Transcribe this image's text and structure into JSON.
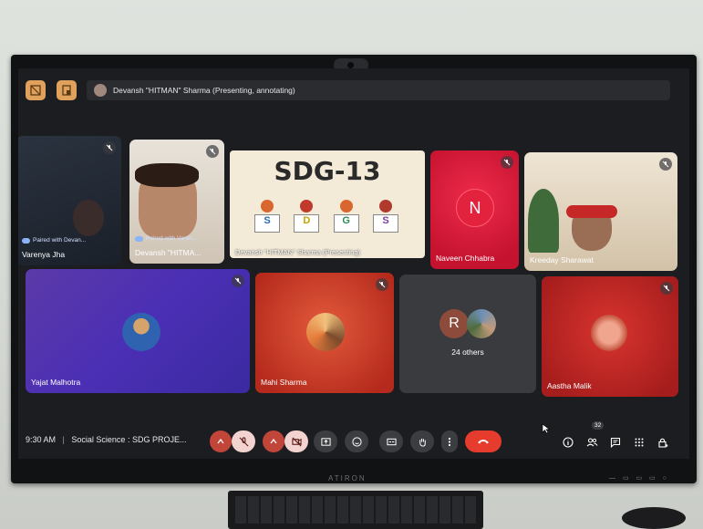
{
  "presenter_bar": {
    "text": "Devansh \"HITMAN\" Sharma (Presenting, annotating)"
  },
  "tiles": {
    "varenya": {
      "name": "Varenya Jha",
      "paired": "Paired with Devan..."
    },
    "devansh": {
      "name": "Devansh \"HITMA...",
      "paired": "Paired with Varen..."
    },
    "presentation": {
      "title": "SDG-13",
      "letters": [
        "S",
        "D",
        "G",
        "S"
      ],
      "footer": "Devansh \"HITMAN\" Sharma (Presenting)"
    },
    "naveen": {
      "name": "Naveen Chhabra",
      "initial": "N"
    },
    "kreeday": {
      "name": "Kreeday Sharawat"
    },
    "yajat": {
      "name": "Yajat Malhotra"
    },
    "mahi": {
      "name": "Mahi Sharma"
    },
    "others": {
      "initial": "R",
      "label": "24 others"
    },
    "aastha": {
      "name": "Aastha Malik"
    }
  },
  "bottombar": {
    "time": "9:30 AM",
    "separator": "|",
    "meeting_title": "Social Science : SDG PROJE...",
    "people_count": "32"
  },
  "hardware": {
    "brand": "ATIRON"
  },
  "colors": {
    "accent_orange": "#e0a15c",
    "end_call_red": "#e53c2e",
    "naveen_bg": "#d81b3a"
  }
}
